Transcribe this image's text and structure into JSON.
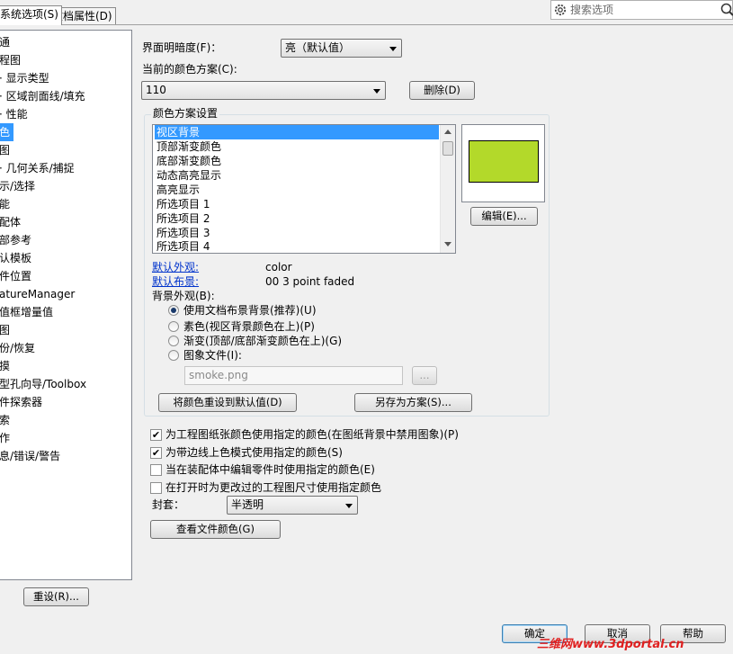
{
  "tabs": [
    "系统选项(S)",
    "文档属性(D)"
  ],
  "search": {
    "placeholder": "搜索选项",
    "icon": "gear-icon"
  },
  "tree": {
    "items": [
      "通",
      "程图",
      "· 显示类型",
      "· 区域剖面线/填充",
      "· 性能",
      "色",
      "图",
      "· 几何关系/捕捉",
      "示/选择",
      "能",
      "配体",
      "部参考",
      "认模板",
      "件位置",
      "atureManager",
      "值框增量值",
      "图",
      "份/恢复",
      "摸",
      "型孔向导/Toolbox",
      "件探索器",
      "索",
      "作",
      "息/错误/警告"
    ],
    "selected_index": 5
  },
  "brightness": {
    "label": "界面明暗度(F)：",
    "value": "亮（默认值）"
  },
  "scheme": {
    "label": "当前的颜色方案(C):",
    "value": "110",
    "delete_button": "删除(D)"
  },
  "color_settings": {
    "title": "颜色方案设置",
    "items": [
      "视区背景",
      "顶部渐变颜色",
      "底部渐变颜色",
      "动态高亮显示",
      "高亮显示",
      "所选项目 1",
      "所选项目 2",
      "所选项目 3",
      "所选项目 4"
    ],
    "selected_index": 0,
    "swatch_color": "#b3d92a",
    "edit_button": "编辑(E)..."
  },
  "defaults": {
    "appearance_label": "默认外观:",
    "appearance_value": "color",
    "scene_label": "默认布景:",
    "scene_value": "00 3 point faded"
  },
  "background": {
    "label": "背景外观(B):",
    "options": [
      "使用文档布景背景(推荐)(U)",
      "素色(视区背景颜色在上)(P)",
      "渐变(顶部/底部渐变颜色在上)(G)",
      "图象文件(I):"
    ],
    "selected_index": 0,
    "file_value": "smoke.png",
    "browse_button": "..."
  },
  "buttons": {
    "reset_colors": "将颜色重设到默认值(D)",
    "save_as_scheme": "另存为方案(S)..."
  },
  "checkboxes": [
    {
      "label": "为工程图纸张颜色使用指定的颜色(在图纸背景中禁用图象)(P)",
      "checked": true
    },
    {
      "label": "为带边线上色模式使用指定的颜色(S)",
      "checked": true
    },
    {
      "label": "当在装配体中编辑零件时使用指定的颜色(E)",
      "checked": false
    },
    {
      "label": "在打开时为更改过的工程图尺寸使用指定颜色",
      "checked": false
    }
  ],
  "envelope": {
    "label": "封套：",
    "value": "半透明"
  },
  "view_file_colors": "查看文件颜色(G)",
  "footer": {
    "reset": "重设(R)...",
    "ok": "确定",
    "cancel": "取消",
    "help": "帮助"
  },
  "watermark": "三维网www.3dportal.cn"
}
